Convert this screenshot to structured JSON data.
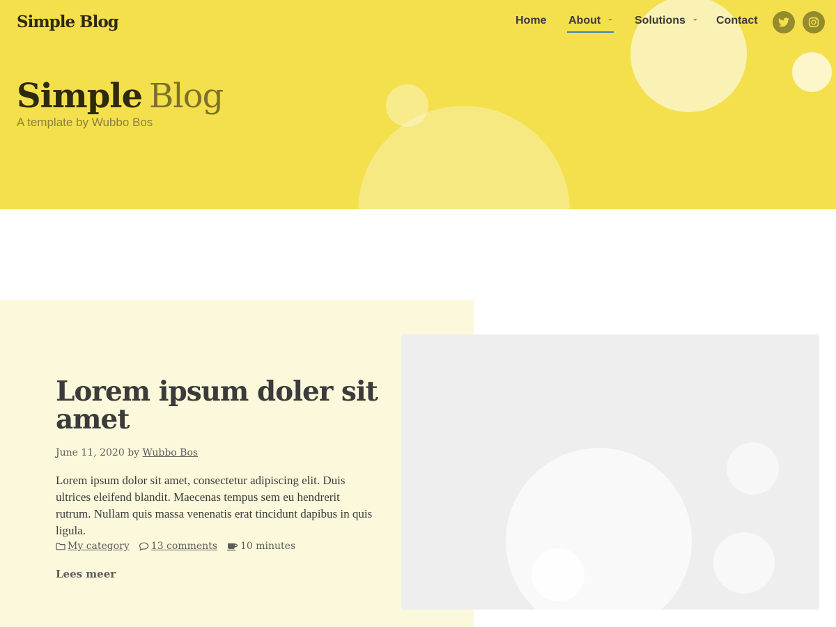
{
  "header": {
    "brand": "Simple Blog",
    "nav": {
      "home": "Home",
      "about": "About",
      "solutions": "Solutions",
      "contact": "Contact"
    },
    "active_nav": "About",
    "social": [
      "twitter-icon",
      "instagram-icon"
    ]
  },
  "hero": {
    "title_strong": "Simple",
    "title_light": "Blog",
    "subtitle": "A template by Wubbo Bos"
  },
  "post": {
    "title": "Lorem ipsum doler sit amet",
    "date": "June 11, 2020",
    "by": "by",
    "author": "Wubbo Bos",
    "excerpt": "Lorem ipsum dolor sit amet, consectetur adipiscing elit. Duis ultrices eleifend blandit. Maecenas tempus sem eu hendrerit rutrum. Nullam quis massa venenatis erat tincidunt dapibus in quis ligula.",
    "category": "My category",
    "comments": "13 comments",
    "read_time": "10 minutes",
    "read_more": "Lees meer"
  },
  "colors": {
    "hero_background": "#f4e04d",
    "post_panel": "#fcf8db",
    "nav_underline": "#3d86a6",
    "social_circle": "#948a2e",
    "image_placeholder": "#eeeeee"
  }
}
